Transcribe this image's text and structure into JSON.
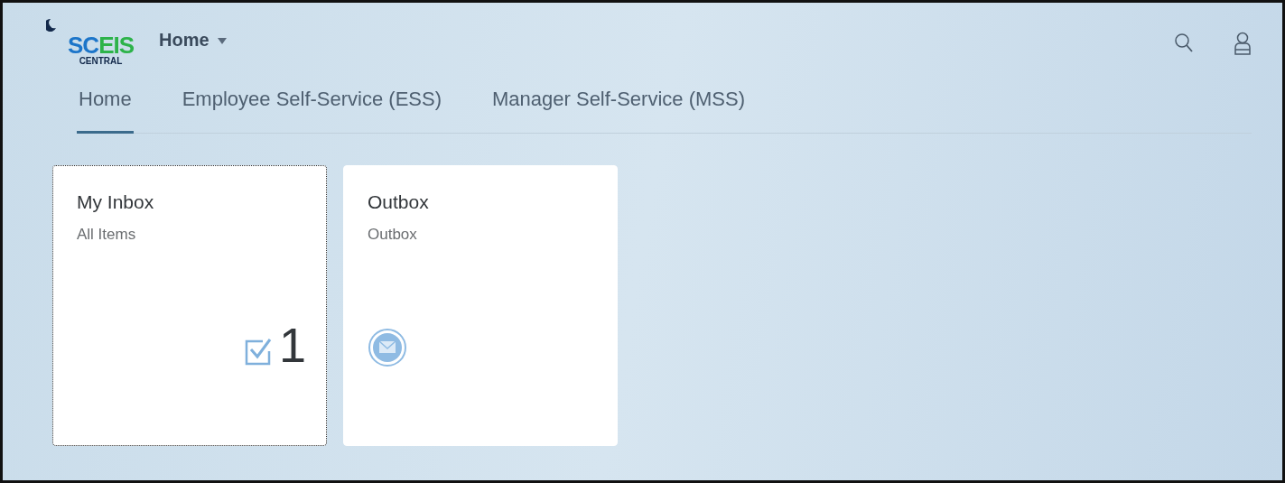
{
  "logo": {
    "parts": [
      {
        "text": "SC",
        "color": "#1c75c9"
      },
      {
        "text": "EIS",
        "color": "#2db34a"
      }
    ],
    "subtitle": "CENTRAL"
  },
  "header": {
    "title": "Home"
  },
  "tabs": [
    {
      "label": "Home",
      "selected": true
    },
    {
      "label": "Employee Self-Service (ESS)",
      "selected": false
    },
    {
      "label": "Manager Self-Service (MSS)",
      "selected": false
    }
  ],
  "tiles": [
    {
      "kind": "inbox",
      "title": "My Inbox",
      "subtitle": "All Items",
      "count": "1",
      "focused": true
    },
    {
      "kind": "outbox",
      "title": "Outbox",
      "subtitle": "Outbox",
      "focused": false
    }
  ]
}
